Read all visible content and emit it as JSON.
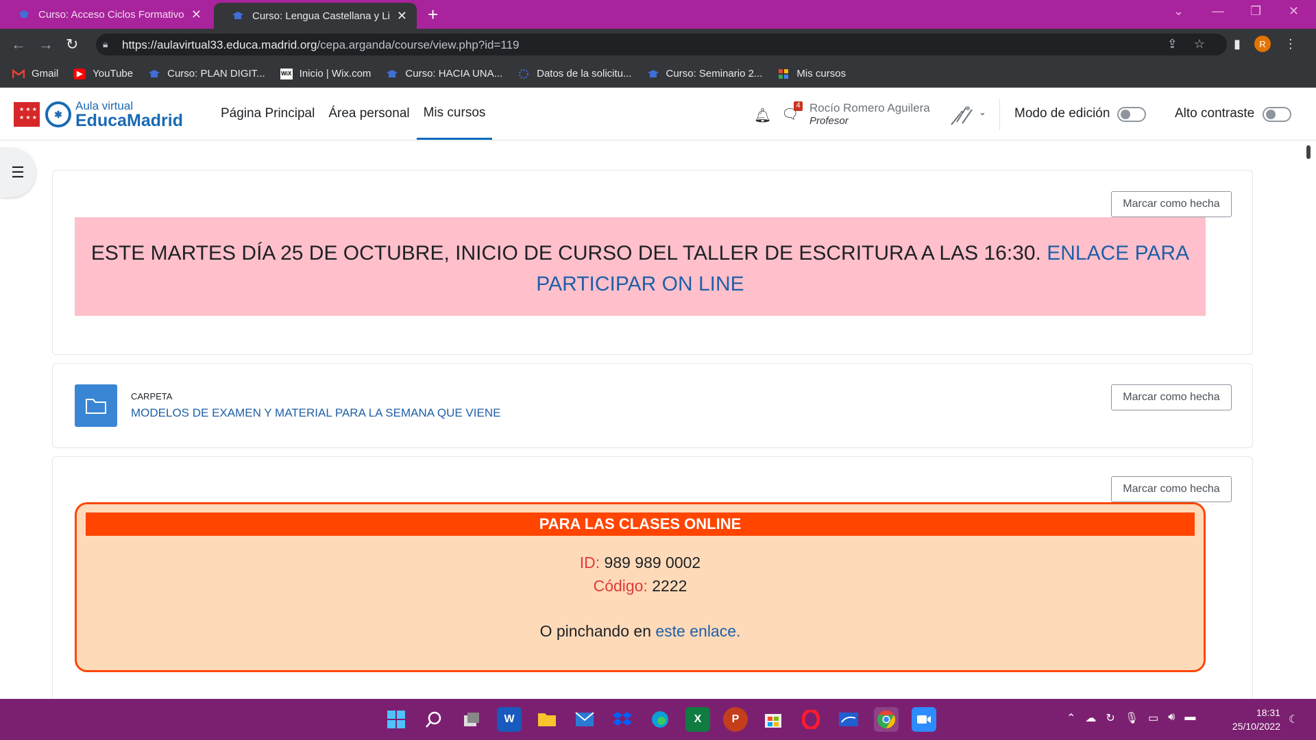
{
  "browser": {
    "tabs": [
      {
        "title": "Curso: Acceso Ciclos Formativos",
        "active": false
      },
      {
        "title": "Curso: Lengua Castellana y Litera",
        "active": true
      }
    ],
    "url_host": "https://aulavirtual33.educa.madrid.org",
    "url_path": "/cepa.arganda/course/view.php?id=119",
    "profile_initial": "R",
    "bookmarks": [
      {
        "label": "Gmail",
        "icon": "gmail-icon"
      },
      {
        "label": "YouTube",
        "icon": "youtube-icon"
      },
      {
        "label": "Curso: PLAN DIGIT...",
        "icon": "moodle-icon"
      },
      {
        "label": "Inicio | Wix.com",
        "icon": "wix-icon"
      },
      {
        "label": "Curso: HACIA UNA...",
        "icon": "moodle-icon"
      },
      {
        "label": "Datos de la solicitu...",
        "icon": "loading-icon"
      },
      {
        "label": "Curso: Seminario 2...",
        "icon": "moodle-icon"
      },
      {
        "label": "Mis cursos",
        "icon": "apps-icon"
      }
    ]
  },
  "header": {
    "logo_line1": "Aula virtual",
    "logo_line2": "EducaMadrid",
    "nav": [
      "Página Principal",
      "Área personal",
      "Mis cursos"
    ],
    "active_nav": "Mis cursos",
    "message_count": "4",
    "user_name": "Rocío Romero Aguilera",
    "user_role": "Profesor",
    "edit_mode_label": "Modo de edición",
    "high_contrast_label": "Alto contraste"
  },
  "content": {
    "mark_done_label": "Marcar como hecha",
    "banner_text": "ESTE MARTES DÍA 25 DE OCTUBRE, INICIO DE CURSO DEL TALLER DE ESCRITURA A LAS 16:30.",
    "banner_link": "ENLACE PARA PARTICIPAR ON LINE",
    "folder_type": "CARPETA",
    "folder_title": "MODELOS DE EXAMEN Y MATERIAL PARA LA SEMANA QUE VIENE",
    "online_title": "PARA LAS CLASES ONLINE",
    "id_label": "ID:",
    "id_value": "989 989 0002",
    "code_label": "Código:",
    "code_value": "2222",
    "link_prefix": "O pinchando en",
    "link_text": "este enlace."
  },
  "taskbar": {
    "apps": [
      "windows-start-icon",
      "search-icon",
      "task-view-icon",
      "word-icon",
      "file-explorer-icon",
      "mail-icon",
      "dropbox-icon",
      "edge-icon",
      "excel-icon",
      "powerpoint-icon",
      "store-icon",
      "opera-icon",
      "whiteboard-icon",
      "chrome-icon",
      "zoom-icon"
    ],
    "time": "18:31",
    "date": "25/10/2022"
  },
  "colors": {
    "tabbar": "#a8239c",
    "banner_bg": "#ffc0cb",
    "online_bg": "#ffdab9",
    "online_accent": "#ff4500",
    "link": "#1f5fa8"
  }
}
